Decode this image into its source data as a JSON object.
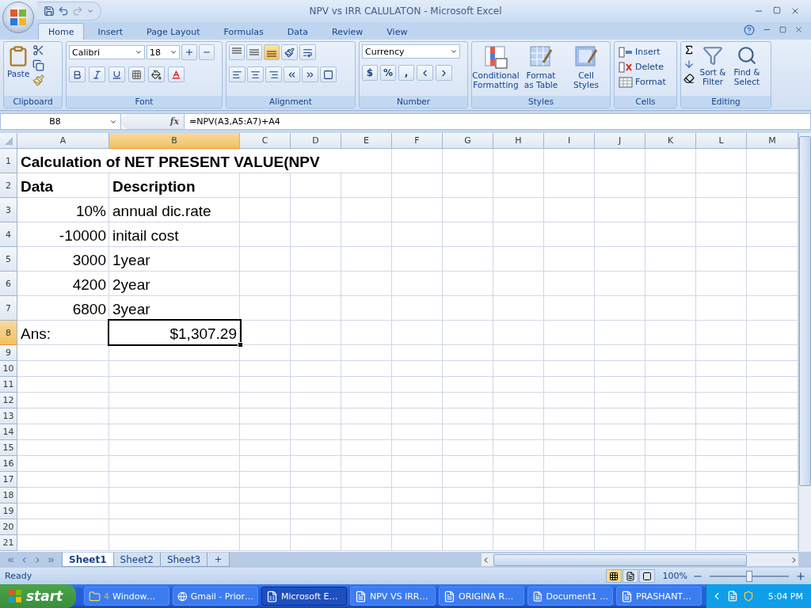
{
  "window": {
    "title": "NPV vs IRR CALULATON - Microsoft Excel"
  },
  "tabs": [
    {
      "label": "Home",
      "selected": true
    },
    {
      "label": "Insert",
      "selected": false
    },
    {
      "label": "Page Layout",
      "selected": false
    },
    {
      "label": "Formulas",
      "selected": false
    },
    {
      "label": "Data",
      "selected": false
    },
    {
      "label": "Review",
      "selected": false
    },
    {
      "label": "View",
      "selected": false
    }
  ],
  "ribbon": {
    "clipboard": {
      "label": "Clipboard",
      "paste": "Paste"
    },
    "font": {
      "label": "Font",
      "name": "Calibri",
      "size": "18"
    },
    "alignment": {
      "label": "Alignment",
      "vertical": [
        {
          "selected": false
        },
        {
          "selected": false
        },
        {
          "selected": true
        }
      ]
    },
    "number": {
      "label": "Number",
      "format": "Currency",
      "buttons": [
        "$",
        "%",
        ","
      ]
    },
    "styles": {
      "label": "Styles",
      "buttons": [
        {
          "label": "Conditional Formatting",
          "kind": "conditional"
        },
        {
          "label": "Format as Table",
          "kind": "table"
        },
        {
          "label": "Cell Styles",
          "kind": "cell"
        }
      ]
    },
    "cells": {
      "label": "Cells",
      "buttons": [
        {
          "label": "Insert",
          "kind": "insert"
        },
        {
          "label": "Delete",
          "kind": "delete"
        },
        {
          "label": "Format",
          "kind": "format"
        }
      ]
    },
    "editing": {
      "label": "Editing",
      "buttons": [
        {
          "label": "Sort & Filter",
          "kind": "sort"
        },
        {
          "label": "Find & Select",
          "kind": "find"
        }
      ]
    }
  },
  "formula_bar": {
    "name_box": "B8",
    "function_label": "fx",
    "formula": "=NPV(A3,A5:A7)+A4"
  },
  "sheet": {
    "columns": [
      {
        "label": "A",
        "selected": false
      },
      {
        "label": "B",
        "selected": true
      },
      {
        "label": "C",
        "selected": false
      },
      {
        "label": "D",
        "selected": false
      },
      {
        "label": "E",
        "selected": false
      },
      {
        "label": "F",
        "selected": false
      },
      {
        "label": "G",
        "selected": false
      },
      {
        "label": "H",
        "selected": false
      },
      {
        "label": "I",
        "selected": false
      },
      {
        "label": "J",
        "selected": false
      },
      {
        "label": "K",
        "selected": false
      },
      {
        "label": "L",
        "selected": false
      },
      {
        "label": "M",
        "selected": false
      }
    ],
    "rows": [
      {
        "label": "1",
        "kind": "tall",
        "selected": false,
        "cells": [
          {
            "text": "Calculation of NET PRESENT VALUE(NPV",
            "bold": true,
            "numeric": false,
            "selected": false
          }
        ]
      },
      {
        "label": "2",
        "kind": "tall",
        "selected": false,
        "cells": [
          {
            "text": "Data",
            "bold": true,
            "numeric": false,
            "selected": false
          },
          {
            "text": "Description",
            "bold": true,
            "numeric": false,
            "selected": false
          }
        ]
      },
      {
        "label": "3",
        "kind": "tall",
        "selected": false,
        "cells": [
          {
            "text": "10%",
            "bold": false,
            "numeric": true,
            "selected": false
          },
          {
            "text": "annual dic.rate",
            "bold": false,
            "numeric": false,
            "selected": false
          }
        ]
      },
      {
        "label": "4",
        "kind": "tall",
        "selected": false,
        "cells": [
          {
            "text": "-10000",
            "bold": false,
            "numeric": true,
            "selected": false
          },
          {
            "text": "initail cost",
            "bold": false,
            "numeric": false,
            "selected": false
          }
        ]
      },
      {
        "label": "5",
        "kind": "tall",
        "selected": false,
        "cells": [
          {
            "text": "3000",
            "bold": false,
            "numeric": true,
            "selected": false
          },
          {
            "text": "1year",
            "bold": false,
            "numeric": false,
            "selected": false
          }
        ]
      },
      {
        "label": "6",
        "kind": "tall",
        "selected": false,
        "cells": [
          {
            "text": "4200",
            "bold": false,
            "numeric": true,
            "selected": false
          },
          {
            "text": "2year",
            "bold": false,
            "numeric": false,
            "selected": false
          }
        ]
      },
      {
        "label": "7",
        "kind": "tall",
        "selected": false,
        "cells": [
          {
            "text": "6800",
            "bold": false,
            "numeric": true,
            "selected": false
          },
          {
            "text": "3year",
            "bold": false,
            "numeric": false,
            "selected": false
          }
        ]
      },
      {
        "label": "8",
        "kind": "tall",
        "selected": true,
        "cells": [
          {
            "text": "Ans:",
            "bold": false,
            "numeric": false,
            "selected": false
          },
          {
            "text": "$1,307.29",
            "bold": false,
            "numeric": true,
            "selected": true
          }
        ]
      },
      {
        "label": "9",
        "kind": "short",
        "selected": false
      },
      {
        "label": "10",
        "kind": "short",
        "selected": false
      },
      {
        "label": "11",
        "kind": "short",
        "selected": false
      },
      {
        "label": "12",
        "kind": "short",
        "selected": false
      },
      {
        "label": "13",
        "kind": "short",
        "selected": false
      },
      {
        "label": "14",
        "kind": "short",
        "selected": false
      },
      {
        "label": "15",
        "kind": "short",
        "selected": false
      },
      {
        "label": "16",
        "kind": "short",
        "selected": false
      },
      {
        "label": "17",
        "kind": "short",
        "selected": false
      },
      {
        "label": "18",
        "kind": "short",
        "selected": false
      },
      {
        "label": "19",
        "kind": "short",
        "selected": false
      },
      {
        "label": "20",
        "kind": "short",
        "selected": false
      },
      {
        "label": "21",
        "kind": "short",
        "selected": false
      }
    ]
  },
  "sheet_tabs": [
    {
      "label": "Sheet1",
      "selected": true
    },
    {
      "label": "Sheet2",
      "selected": false
    },
    {
      "label": "Sheet3",
      "selected": false
    }
  ],
  "status_bar": {
    "text": "Ready",
    "views": [
      {
        "kind": "normal",
        "selected": true
      },
      {
        "kind": "layout",
        "selected": false
      },
      {
        "kind": "break",
        "selected": false
      }
    ],
    "zoom": "100%",
    "zoom_slider": {
      "level": 0.5
    }
  },
  "taskbar": {
    "start": "start",
    "items": [
      {
        "kind": "folder",
        "count": "4",
        "label": "Window…",
        "selected": false
      },
      {
        "kind": "browser",
        "label": "Gmail - Prior…",
        "selected": false
      },
      {
        "kind": "excel",
        "label": "Microsoft E…",
        "selected": true
      },
      {
        "kind": "word",
        "label": "NPV VS IRR…",
        "selected": false
      },
      {
        "kind": "word",
        "label": "ORIGINA R…",
        "selected": false
      },
      {
        "kind": "word",
        "label": "Document1 …",
        "selected": false
      },
      {
        "kind": "word",
        "label": "PRASHANT…",
        "selected": false
      }
    ],
    "clock": "5:04 PM"
  }
}
